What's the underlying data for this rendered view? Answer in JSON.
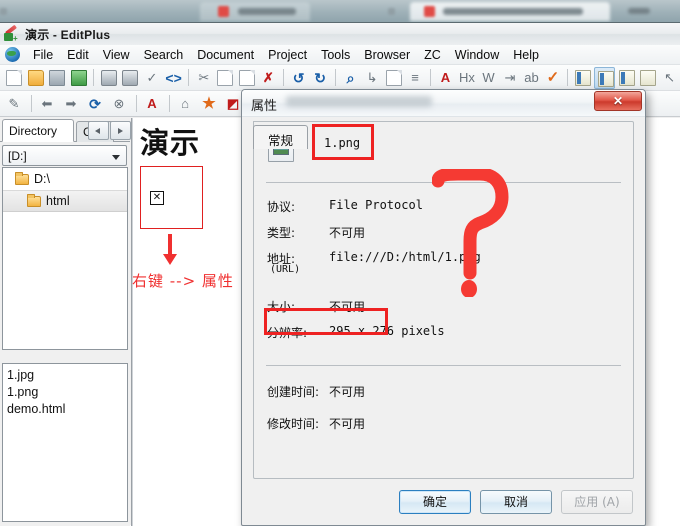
{
  "window": {
    "title": "演示 - EditPlus",
    "logo_icon": "editplus-logo-icon"
  },
  "menubar": {
    "globe_icon": "globe-icon",
    "items": [
      "File",
      "Edit",
      "View",
      "Search",
      "Document",
      "Project",
      "Tools",
      "Browser",
      "ZC",
      "Window",
      "Help"
    ]
  },
  "toolbar1": {
    "buttons": [
      {
        "name": "new-document",
        "glyph": "doc"
      },
      {
        "name": "open-file",
        "glyph": "folder"
      },
      {
        "name": "save-file",
        "glyph": "disk"
      },
      {
        "name": "save-all",
        "glyph": "green"
      },
      {
        "name": "print-preview",
        "glyph": "print2"
      },
      {
        "name": "print",
        "glyph": "print"
      },
      {
        "name": "spell-check",
        "glyph": "abc"
      },
      {
        "name": "view-source",
        "glyph": "code"
      },
      {
        "name": "cut",
        "glyph": "scissors"
      },
      {
        "name": "copy",
        "glyph": "copy"
      },
      {
        "name": "paste",
        "glyph": "clipboard"
      },
      {
        "name": "delete",
        "glyph": "redx"
      },
      {
        "name": "undo",
        "glyph": "undo"
      },
      {
        "name": "redo",
        "glyph": "redo"
      },
      {
        "name": "find",
        "glyph": "magnifier"
      },
      {
        "name": "replace",
        "glyph": "replace"
      },
      {
        "name": "find-in-files",
        "glyph": "findfiles"
      },
      {
        "name": "goto-line",
        "glyph": "goto"
      },
      {
        "name": "font",
        "glyph": "bigA"
      },
      {
        "name": "hex-view",
        "glyph": "hx"
      },
      {
        "name": "word-wrap",
        "glyph": "w"
      },
      {
        "name": "indent",
        "glyph": "indent"
      },
      {
        "name": "case-convert",
        "glyph": "abcd"
      },
      {
        "name": "spell",
        "glyph": "check"
      },
      {
        "name": "toggle-directory",
        "glyph": "panel"
      },
      {
        "name": "toggle-output",
        "glyph": "panel2"
      },
      {
        "name": "toggle-cliptext",
        "glyph": "panel3"
      },
      {
        "name": "toggle-fullscreen",
        "glyph": "panel4"
      },
      {
        "name": "select-mode",
        "glyph": "cursor"
      }
    ]
  },
  "toolbar2": {
    "buttons": [
      {
        "name": "edit-pencil",
        "glyph": "pencil"
      },
      {
        "name": "browser-back",
        "glyph": "back"
      },
      {
        "name": "browser-forward",
        "glyph": "fwd"
      },
      {
        "name": "browser-refresh",
        "glyph": "refresh"
      },
      {
        "name": "browser-stop",
        "glyph": "stop"
      },
      {
        "name": "font-color",
        "glyph": "letterA"
      },
      {
        "name": "home-page",
        "glyph": "home"
      },
      {
        "name": "favorites",
        "glyph": "star"
      },
      {
        "name": "add-favorite",
        "glyph": "addfav"
      }
    ]
  },
  "left_panel": {
    "tabs": [
      {
        "label": "Directory",
        "selected": true
      },
      {
        "label": "Cli",
        "selected": false
      }
    ],
    "nav_prev_icon": "chevron-left-icon",
    "nav_next_icon": "chevron-right-icon",
    "drive_selector": {
      "value": "[D:]",
      "caret_icon": "chevron-down-icon"
    },
    "tree": [
      {
        "label": "D:\\",
        "icon": "folder-icon",
        "selected": false,
        "depth": 0
      },
      {
        "label": "html",
        "icon": "folder-icon",
        "selected": true,
        "depth": 1
      }
    ],
    "files": [
      "1.jpg",
      "1.png",
      "demo.html"
    ]
  },
  "editor": {
    "heading": "演示",
    "broken_image_alt_icon": "broken-image-icon",
    "annotation_arrow_icon": "red-arrow-down-icon",
    "annotation_text": "右键 --> 属性"
  },
  "dialog": {
    "title": "属性",
    "close_label": "✕",
    "close_icon": "close-icon",
    "tab": "常规",
    "file_icon": "image-file-icon",
    "file_name": "1.png",
    "rows": [
      {
        "label": "协议:",
        "value": "File Protocol",
        "sublabel": "",
        "cjk": false
      },
      {
        "label": "类型:",
        "value": "不可用",
        "sublabel": "",
        "cjk": true,
        "highlighted": true
      },
      {
        "label": "地址:",
        "value": "file:///D:/html/1.png",
        "sublabel": "(URL)",
        "cjk": false
      },
      {
        "label": "大小:",
        "value": "不可用",
        "sublabel": "",
        "cjk": true
      },
      {
        "label": "分辨率:",
        "value": "295  x  276  pixels",
        "sublabel": "",
        "cjk": false
      },
      {
        "label": "创建时间:",
        "value": "不可用",
        "sublabel": "",
        "cjk": true
      },
      {
        "label": "修改时间:",
        "value": "不可用",
        "sublabel": "",
        "cjk": true
      }
    ],
    "buttons": [
      {
        "label": "确定",
        "state": "focus"
      },
      {
        "label": "取消",
        "state": "normal"
      },
      {
        "label": "应用 (A)",
        "state": "disabled"
      }
    ]
  },
  "annotations": {
    "question_mark_icon": "red-question-mark-icon",
    "accent_color": "#ee2222"
  }
}
